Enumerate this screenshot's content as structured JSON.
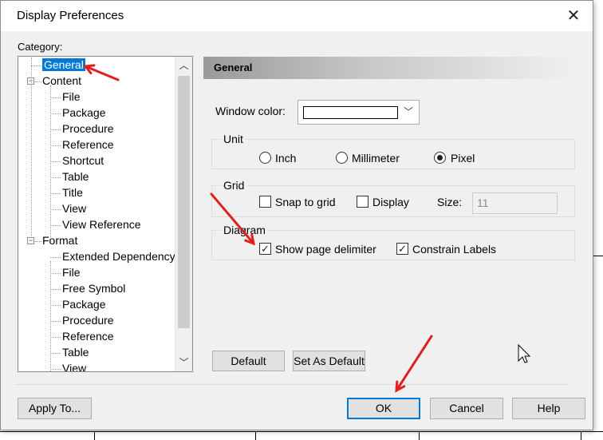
{
  "dialog": {
    "title": "Display Preferences",
    "close_label": "✕"
  },
  "category": {
    "label": "Category:",
    "tree": [
      {
        "label": "General",
        "level": 1,
        "selected": true
      },
      {
        "label": "Content",
        "level": 0,
        "expandable": true
      },
      {
        "label": "File",
        "level": 2
      },
      {
        "label": "Package",
        "level": 2
      },
      {
        "label": "Procedure",
        "level": 2
      },
      {
        "label": "Reference",
        "level": 2
      },
      {
        "label": "Shortcut",
        "level": 2
      },
      {
        "label": "Table",
        "level": 2
      },
      {
        "label": "Title",
        "level": 2
      },
      {
        "label": "View",
        "level": 2
      },
      {
        "label": "View Reference",
        "level": 2
      },
      {
        "label": "Format",
        "level": 0,
        "expandable": true
      },
      {
        "label": "Extended Dependency",
        "level": 2
      },
      {
        "label": "File",
        "level": 2
      },
      {
        "label": "Free Symbol",
        "level": 2
      },
      {
        "label": "Package",
        "level": 2
      },
      {
        "label": "Procedure",
        "level": 2
      },
      {
        "label": "Reference",
        "level": 2
      },
      {
        "label": "Table",
        "level": 2
      },
      {
        "label": "View",
        "level": 2
      }
    ]
  },
  "panel": {
    "header": "General",
    "window_color_label": "Window color:",
    "window_color_value": "#ffffff",
    "unit": {
      "title": "Unit",
      "options": [
        {
          "label": "Inch",
          "selected": false
        },
        {
          "label": "Millimeter",
          "selected": false
        },
        {
          "label": "Pixel",
          "selected": true
        }
      ]
    },
    "grid": {
      "title": "Grid",
      "snap_label": "Snap to grid",
      "snap_checked": false,
      "display_label": "Display",
      "display_checked": false,
      "size_label": "Size:",
      "size_value": "11"
    },
    "diagram": {
      "title": "Diagram",
      "show_page_delimiter_label": "Show page delimiter",
      "show_page_delimiter_checked": true,
      "constrain_labels_label": "Constrain Labels",
      "constrain_labels_checked": true
    },
    "default_button": "Default",
    "set_as_default_button": "Set As Default"
  },
  "footer": {
    "apply_to": "Apply To...",
    "ok": "OK",
    "cancel": "Cancel",
    "help": "Help"
  },
  "annotation_color": "#e02020"
}
